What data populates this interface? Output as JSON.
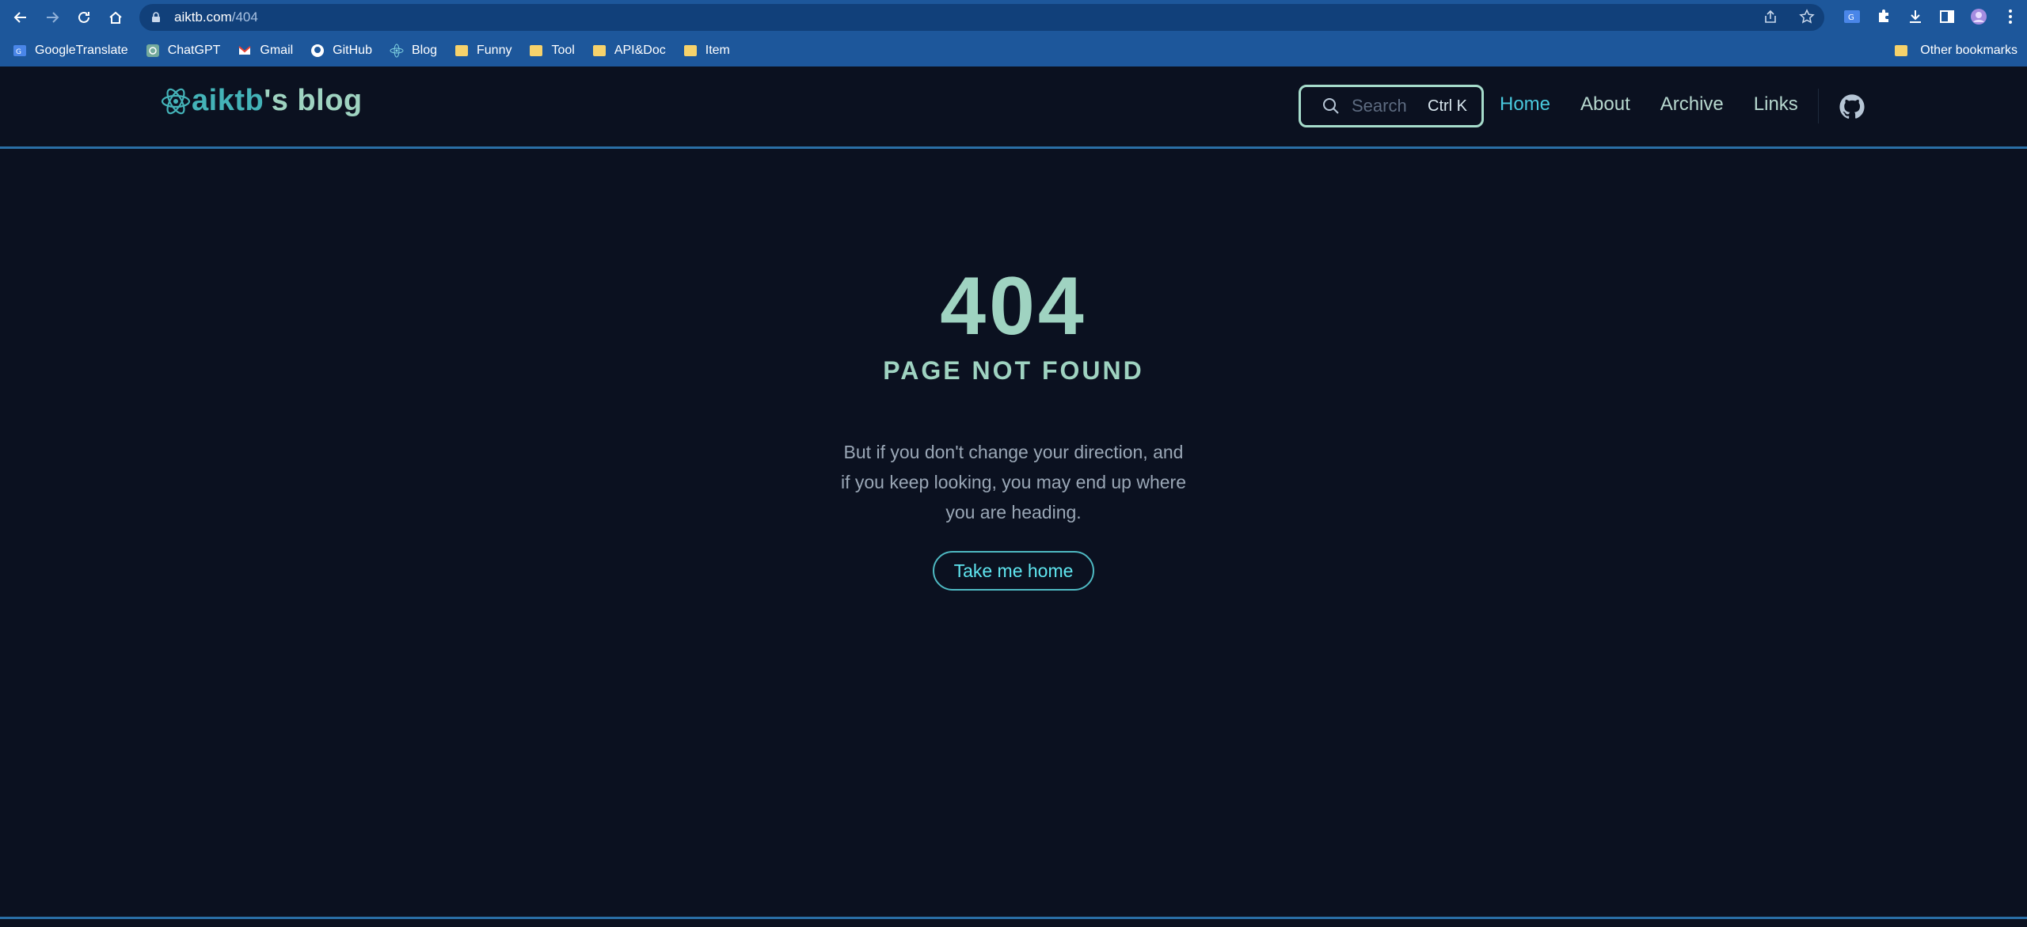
{
  "browser": {
    "url_host": "aiktb.com",
    "url_path": "/404",
    "bookmarks": [
      {
        "label": "GoogleTranslate",
        "icon": "google-translate-icon"
      },
      {
        "label": "ChatGPT",
        "icon": "chatgpt-icon"
      },
      {
        "label": "Gmail",
        "icon": "gmail-icon"
      },
      {
        "label": "GitHub",
        "icon": "github-icon"
      },
      {
        "label": "Blog",
        "icon": "atom-icon"
      },
      {
        "label": "Funny",
        "icon": "folder-icon"
      },
      {
        "label": "Tool",
        "icon": "folder-icon"
      },
      {
        "label": "API&Doc",
        "icon": "folder-icon"
      },
      {
        "label": "Item",
        "icon": "folder-icon"
      }
    ],
    "other_bookmarks": "Other bookmarks"
  },
  "site": {
    "brand_accent": "aiktb",
    "brand_rest": "'s blog",
    "search_placeholder": "Search",
    "search_shortcut": "Ctrl K",
    "nav": [
      {
        "label": "Home",
        "active": true
      },
      {
        "label": "About",
        "active": false
      },
      {
        "label": "Archive",
        "active": false
      },
      {
        "label": "Links",
        "active": false
      }
    ]
  },
  "error": {
    "code": "404",
    "title": "PAGE NOT FOUND",
    "message": "But if you don't change your direction, and if you keep looking, you may end up where you are heading.",
    "button": "Take me home"
  },
  "colors": {
    "background": "#0b1120",
    "accent": "#9fd3c1",
    "link_active": "#49c9dd",
    "chrome": "#1d579b"
  }
}
